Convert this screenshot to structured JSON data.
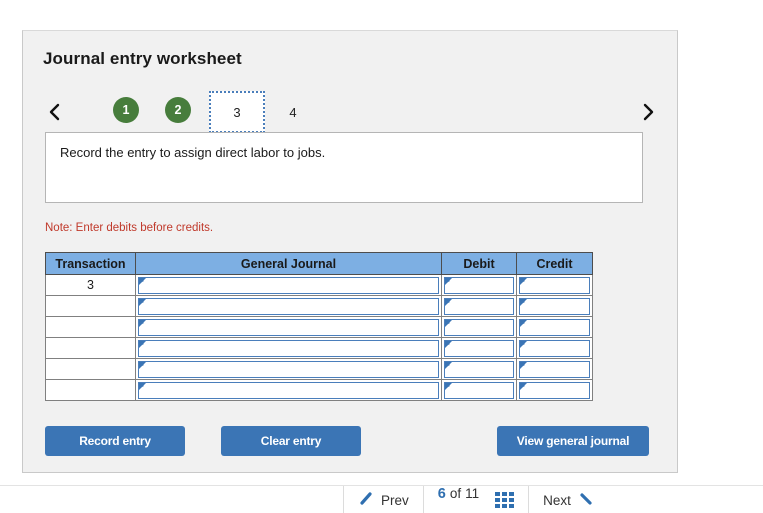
{
  "worksheet": {
    "title": "Journal entry worksheet",
    "prev_step_icon": "chevron-left-icon",
    "next_step_icon": "chevron-right-icon",
    "steps": [
      {
        "label": "1",
        "state": "completed"
      },
      {
        "label": "2",
        "state": "completed"
      },
      {
        "label": "3",
        "state": "current"
      },
      {
        "label": "4",
        "state": "upcoming"
      }
    ],
    "instruction": "Record the entry to assign direct labor to jobs.",
    "note": "Note: Enter debits before credits."
  },
  "journal": {
    "columns": [
      "Transaction",
      "General Journal",
      "Debit",
      "Credit"
    ],
    "rows": [
      {
        "transaction": "3",
        "general_journal": "",
        "debit": "",
        "credit": ""
      },
      {
        "transaction": "",
        "general_journal": "",
        "debit": "",
        "credit": ""
      },
      {
        "transaction": "",
        "general_journal": "",
        "debit": "",
        "credit": ""
      },
      {
        "transaction": "",
        "general_journal": "",
        "debit": "",
        "credit": ""
      },
      {
        "transaction": "",
        "general_journal": "",
        "debit": "",
        "credit": ""
      },
      {
        "transaction": "",
        "general_journal": "",
        "debit": "",
        "credit": ""
      }
    ]
  },
  "actions": {
    "record_entry": "Record entry",
    "clear_entry": "Clear entry",
    "view_general_journal": "View general journal"
  },
  "pager": {
    "prev_label": "Prev",
    "prev_icon": "pencil-left-icon",
    "current_page": "6",
    "of_label": "of",
    "total_pages": "11",
    "grid_icon": "grid-view-icon",
    "next_label": "Next",
    "next_icon": "arrow-right-icon"
  },
  "colors": {
    "accent_blue": "#3b75b5",
    "header_blue": "#7dafe3",
    "step_green": "#477d3c",
    "note_red": "#c0392b",
    "card_bg": "#f1f1f1"
  }
}
